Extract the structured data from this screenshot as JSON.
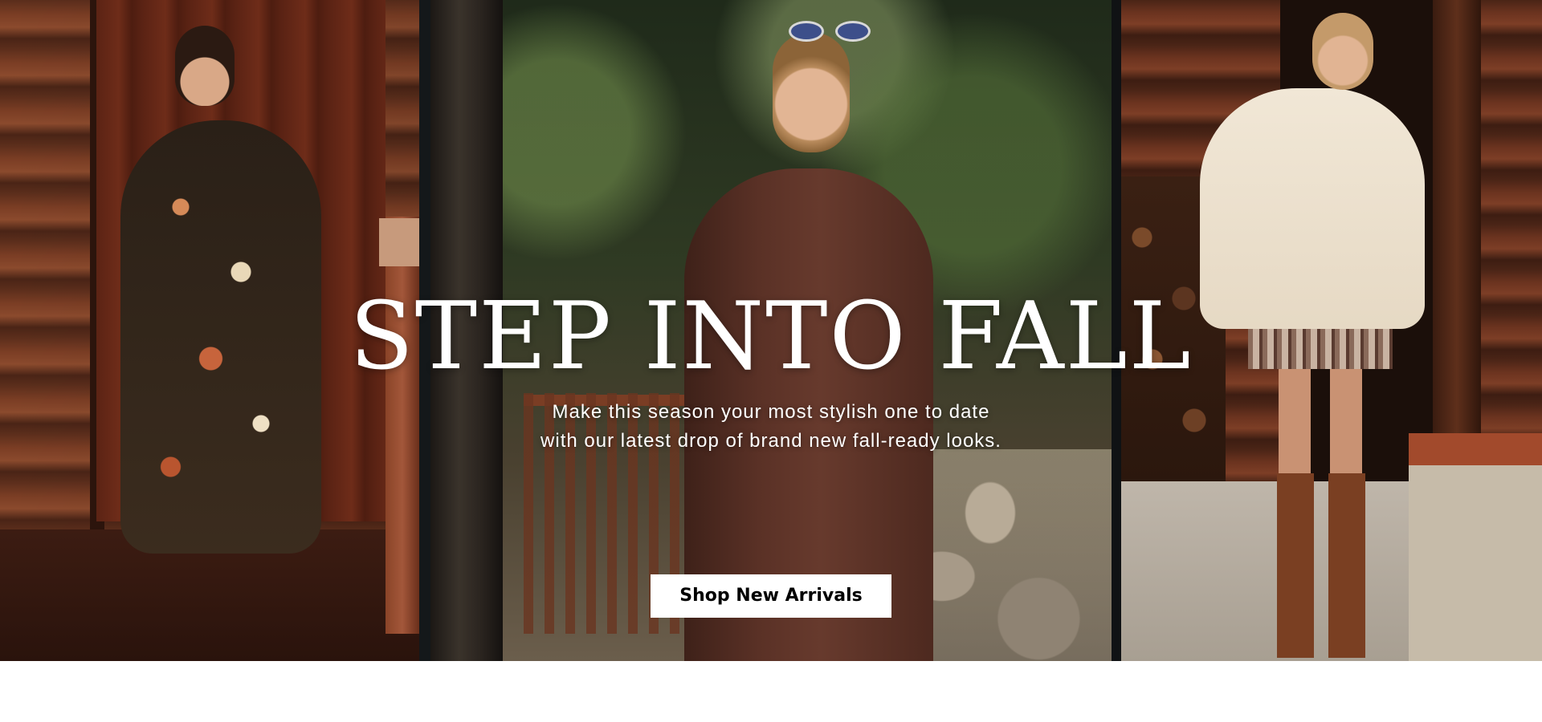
{
  "hero": {
    "headline": "STEP INTO FALL",
    "subtext_line1": "Make this season your most stylish one to date",
    "subtext_line2": "with our latest drop of brand new fall-ready looks.",
    "cta_label": "Shop New Arrivals"
  },
  "colors": {
    "headline_text": "#ffffff",
    "cta_background": "#ffffff",
    "cta_text": "#000000",
    "page_background": "#ffffff"
  }
}
